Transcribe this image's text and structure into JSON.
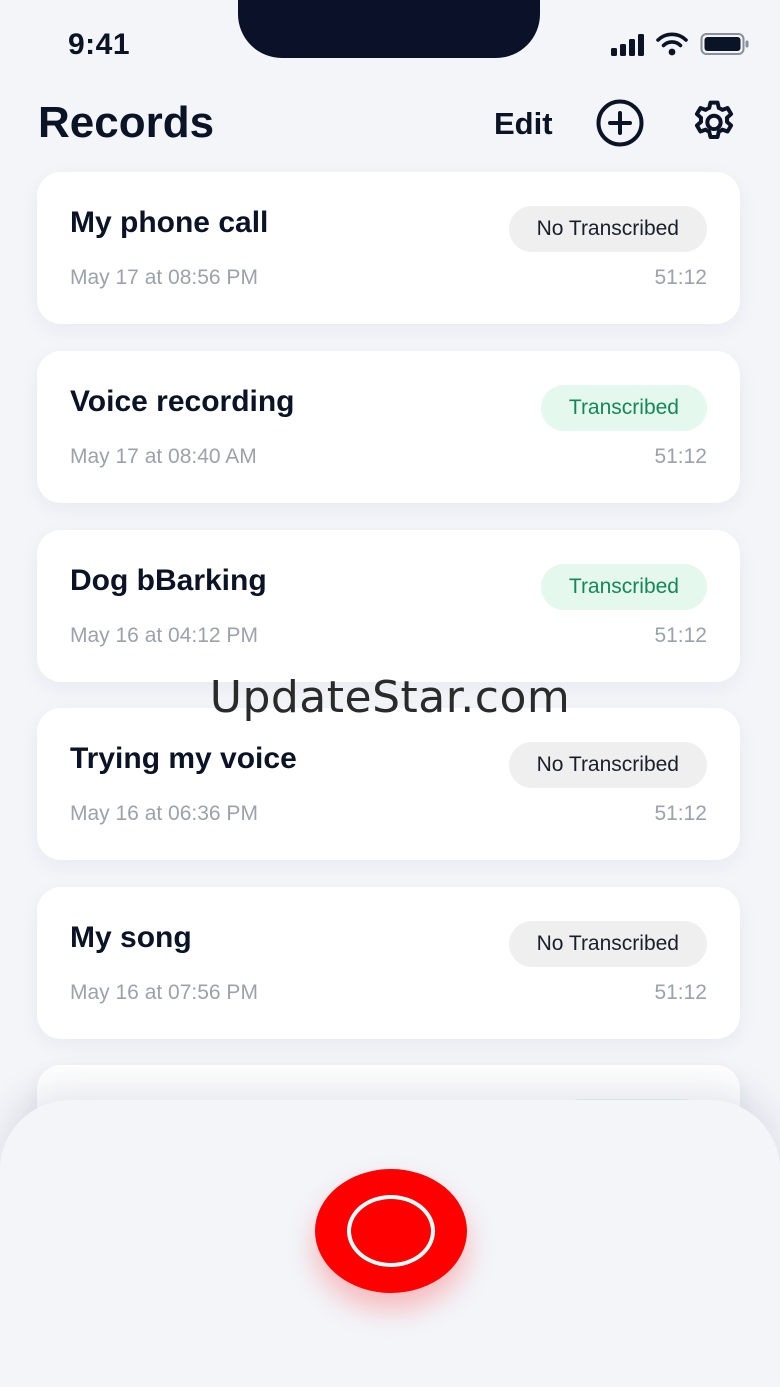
{
  "status_bar": {
    "time": "9:41"
  },
  "header": {
    "title": "Records",
    "edit_label": "Edit"
  },
  "records": [
    {
      "title": "My phone call",
      "date": "May 17 at 08:56 PM",
      "duration": "51:12",
      "status": "No Transcribed",
      "transcribed": false
    },
    {
      "title": "Voice recording",
      "date": "May 17 at 08:40 AM",
      "duration": "51:12",
      "status": "Transcribed",
      "transcribed": true
    },
    {
      "title": "Dog bBarking",
      "date": "May 16 at 04:12 PM",
      "duration": "51:12",
      "status": "Transcribed",
      "transcribed": true
    },
    {
      "title": "Trying my voice",
      "date": "May 16 at 06:36 PM",
      "duration": "51:12",
      "status": "No Transcribed",
      "transcribed": false
    },
    {
      "title": "My song",
      "date": "May 16 at 07:56 PM",
      "duration": "51:12",
      "status": "No Transcribed",
      "transcribed": false
    }
  ],
  "watermark": "UpdateStar.com",
  "colors": {
    "record_button": "#ff0000",
    "transcribed_badge_bg": "#e4f8ee",
    "transcribed_badge_text": "#15875a",
    "untranscribed_badge_bg": "#efeff0"
  },
  "icons": {
    "add": "plus-circle-icon",
    "settings": "gear-icon",
    "record": "record-icon"
  }
}
